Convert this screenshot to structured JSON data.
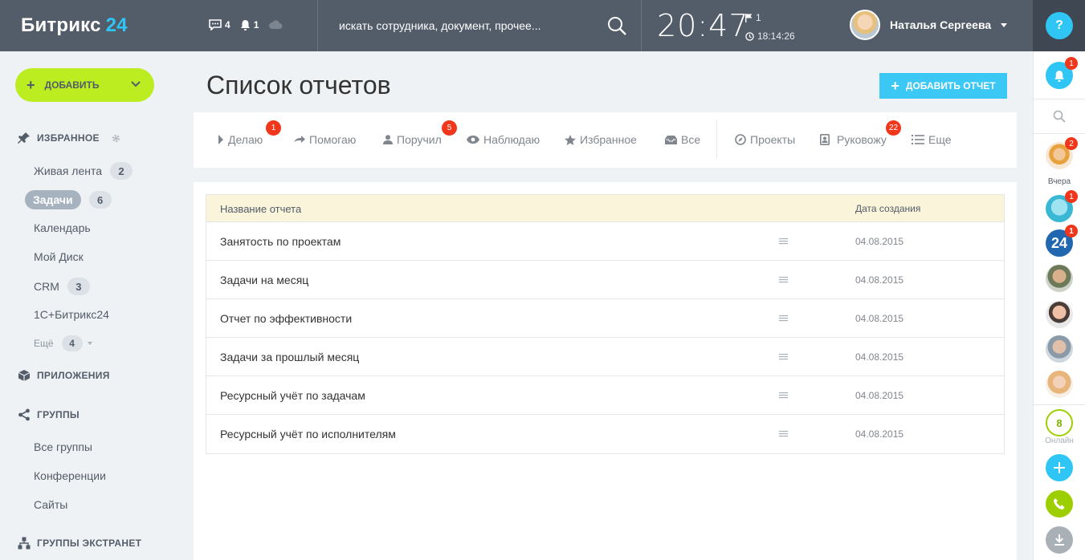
{
  "header": {
    "logo_text": "Битрикс",
    "logo_num": "24",
    "messages_count": "4",
    "notifications_count": "1",
    "search_placeholder": "искать сотрудника, документ, прочее...",
    "time": "20:47",
    "flag_count": "1",
    "work_time": "18:14:26",
    "user_name": "Наталья Сергеева",
    "help_label": "?"
  },
  "sidebar": {
    "add_label": "ДОБАВИТЬ",
    "favorites_title": "ИЗБРАННОЕ",
    "items": [
      {
        "label": "Живая лента",
        "badge": "2"
      },
      {
        "label": "Задачи",
        "badge": "6"
      },
      {
        "label": "Календарь"
      },
      {
        "label": "Мой Диск"
      },
      {
        "label": "CRM",
        "badge": "3"
      },
      {
        "label": "1С+Битрикс24"
      }
    ],
    "more_label": "Ещё",
    "more_badge": "4",
    "apps_title": "ПРИЛОЖЕНИЯ",
    "groups_title": "ГРУППЫ",
    "group_items": [
      "Все группы",
      "Конференции",
      "Сайты"
    ],
    "extranet_title": "ГРУППЫ ЭКСТРАНЕТ"
  },
  "main": {
    "title": "Список отчетов",
    "add_report_label": "ДОБАВИТЬ ОТЧЕТ",
    "tabs": [
      {
        "label": "Делаю",
        "count": "1"
      },
      {
        "label": "Помогаю"
      },
      {
        "label": "Поручил",
        "count": "5"
      },
      {
        "label": "Наблюдаю"
      },
      {
        "label": "Избранное"
      },
      {
        "label": "Все"
      },
      {
        "label": "Проекты"
      },
      {
        "label": "Руковожу",
        "count": "22"
      },
      {
        "label": "Еще"
      }
    ],
    "table": {
      "columns": [
        "Название отчета",
        "Дата создания"
      ],
      "rows": [
        {
          "name": "Занятость по проектам",
          "date": "04.08.2015"
        },
        {
          "name": "Задачи на месяц",
          "date": "04.08.2015"
        },
        {
          "name": "Отчет по эффективности",
          "date": "04.08.2015"
        },
        {
          "name": "Задачи за прошлый месяц",
          "date": "04.08.2015"
        },
        {
          "name": "Ресурсный учёт по задачам",
          "date": "04.08.2015"
        },
        {
          "name": "Ресурсный учёт по исполнителям",
          "date": "04.08.2015"
        }
      ]
    }
  },
  "rightbar": {
    "notif_badge": "1",
    "recent_badge": "2",
    "yesterday_label": "Вчера",
    "chat1_badge": "1",
    "chat2_label": "24",
    "chat2_badge": "1",
    "online_count": "8",
    "online_label": "Онлайн"
  },
  "colors": {
    "header_bg": "#535c69",
    "accent_blue": "#2fc6f6",
    "add_green": "#bbed21",
    "counter_red": "#f0371b",
    "table_header_bg": "#f9f4da"
  }
}
